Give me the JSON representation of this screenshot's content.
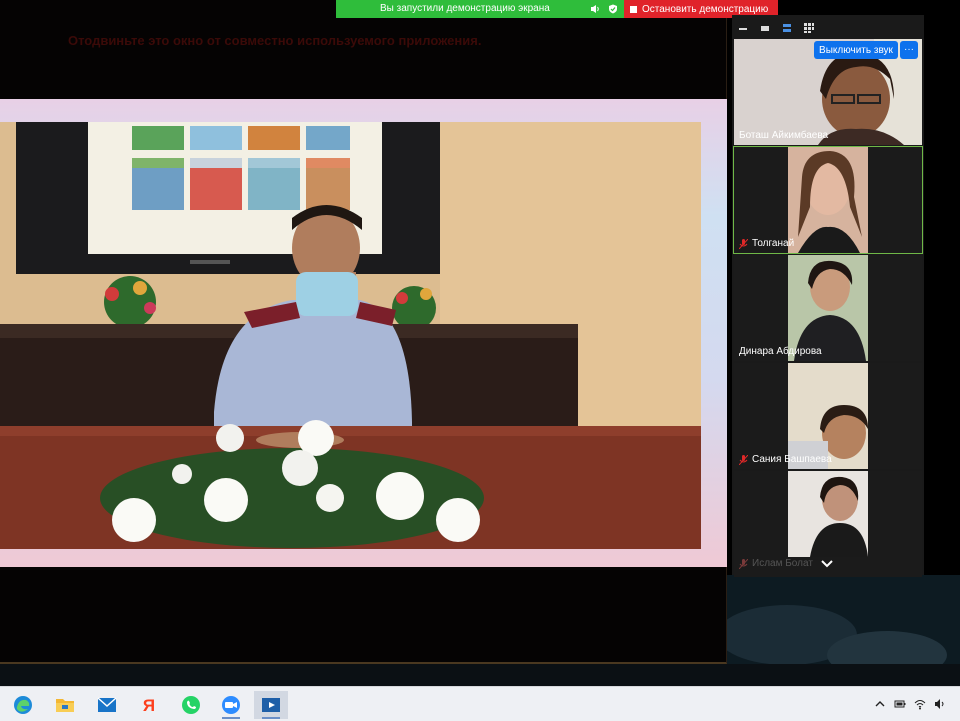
{
  "share_banner": {
    "status_text": "Вы запустили демонстрацию экрана",
    "stop_label": "Остановить демонстрацию"
  },
  "shared_window": {
    "hint_text": "Отодвиньте это окно от совместно используемого приложения."
  },
  "participants_panel": {
    "mute_audio_label": "Выключить звук",
    "more_label": "···",
    "participants": [
      {
        "name": "Боташ Айкимбаева",
        "muted": false,
        "active": false
      },
      {
        "name": "Толганай",
        "muted": true,
        "active": true
      },
      {
        "name": "Динара Абдирова",
        "muted": false,
        "active": false
      },
      {
        "name": "Сания Башпаева",
        "muted": true,
        "active": false
      },
      {
        "name": "Ислам Болат",
        "muted": true,
        "active": false
      }
    ]
  },
  "taskbar": {
    "apps": [
      "edge",
      "file-explorer",
      "mail",
      "yandex-browser",
      "whatsapp",
      "zoom",
      "movies-tv"
    ],
    "tray_icons": [
      "chevron-up",
      "battery",
      "wifi",
      "volume",
      "language"
    ]
  },
  "colors": {
    "share_green": "#2fbd3b",
    "stop_red": "#e0232a",
    "zoom_blue": "#0e72ed",
    "active_border": "#6fb847"
  }
}
